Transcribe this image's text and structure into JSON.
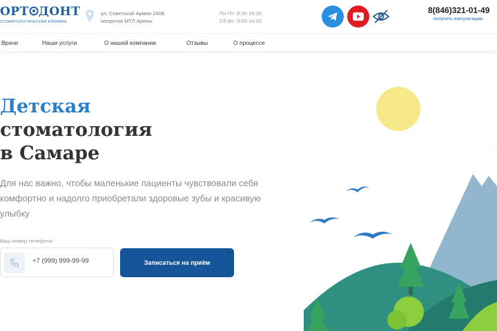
{
  "header": {
    "logo_text_before": "ОРТ",
    "logo_text_after": "ДОНТ",
    "logo_subtitle": "СТОМАТОЛОГИЧЕСКАЯ КЛИНИКА",
    "address_line1": "ул. Советской Армии 240Б",
    "address_line2": "напротив МТЛ Арены",
    "hours_line1": "Пн-Пт: 8:30-19:30",
    "hours_line2": "Сб-Вс: 9:00-14:00",
    "phone": "8(846)321-01-49",
    "consult_link": "получить консультацию",
    "colors": {
      "brand": "#1c5e9e",
      "telegram": "#2a8fe0",
      "youtube": "#e01b22"
    },
    "icons": [
      "map-pin-icon",
      "telegram-icon",
      "youtube-icon",
      "eye-crossed-icon"
    ]
  },
  "nav": {
    "items": [
      {
        "label": "Врачи"
      },
      {
        "label": "Наши услуги"
      },
      {
        "label": "О нашей компании"
      },
      {
        "label": "Отзывы"
      },
      {
        "label": "О процессе"
      }
    ]
  },
  "hero": {
    "title_line1": "Детская",
    "title_line2": "стоматология",
    "title_line3": "в Самаре",
    "description": "Для нас важно, чтобы маленькие пациенты чувствовали себя комфортно и надолго приобретали здоровые зубы и красивую улыбку",
    "form": {
      "phone_label": "Ваш номер телефона:",
      "phone_placeholder": "+7 (999) 999-99-99",
      "submit_label": "Записаться на приём"
    },
    "colors": {
      "title_accent": "#2a7fc6",
      "button": "#17559a"
    }
  }
}
